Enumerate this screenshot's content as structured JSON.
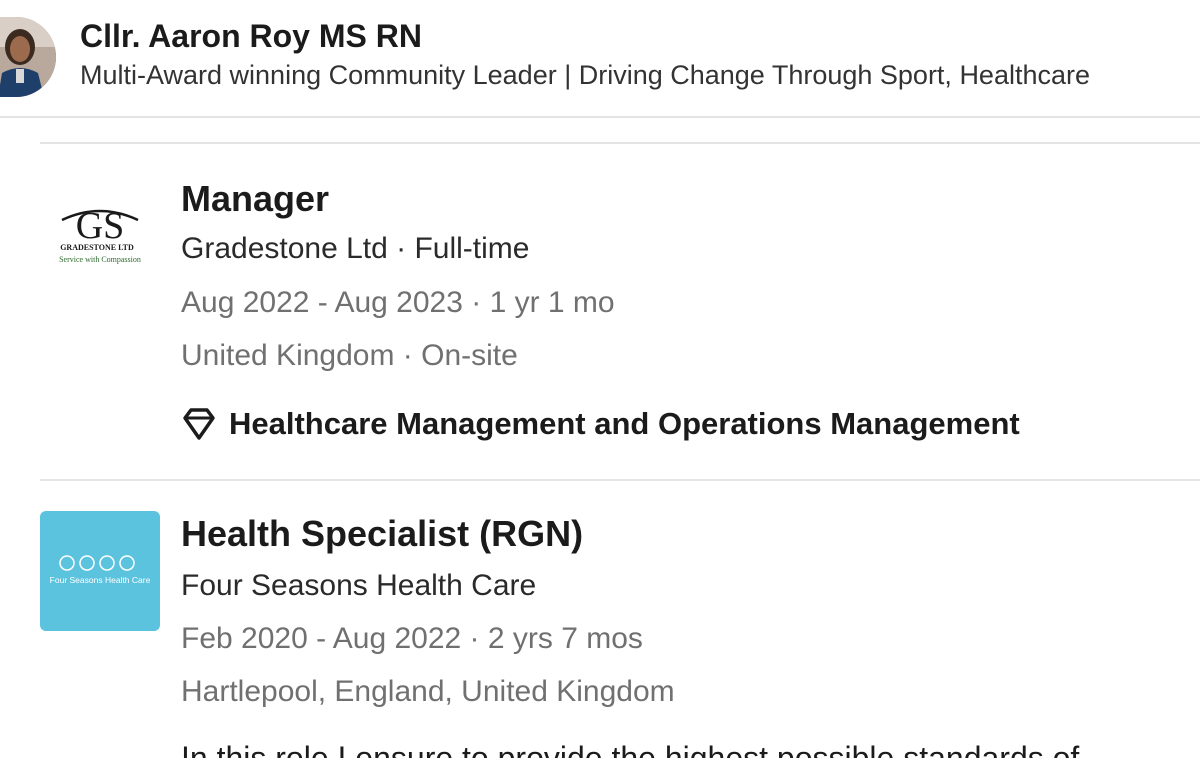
{
  "profile": {
    "name": "Cllr. Aaron Roy MS RN",
    "headline": "Multi-Award winning Community Leader | Driving Change Through Sport, Healthcare"
  },
  "experience": [
    {
      "title": "Manager",
      "company_line": "Gradestone Ltd · Full-time",
      "dates": "Aug 2022 - Aug 2023 · 1 yr 1 mo",
      "location": "United Kingdom · On-site",
      "skills": "Healthcare Management and Operations Management",
      "logo": {
        "monogram": "GS",
        "name": "GRADESTONE LTD",
        "tagline": "Service with Compassion",
        "colors": {
          "text": "#1a1a1a",
          "tagline": "#2d6a2d"
        }
      }
    },
    {
      "title": "Health Specialist (RGN)",
      "company_line": "Four Seasons Health Care",
      "dates": "Feb 2020 - Aug 2022 · 2 yrs 7 mos",
      "location": "Hartlepool, England, United Kingdom",
      "logo": {
        "name": "Four Seasons Health Care",
        "colors": {
          "background": "#5cc3df",
          "text": "#ffffff"
        }
      }
    }
  ],
  "description_cutoff": "In this role I ensure to provide the highest possible standards of"
}
